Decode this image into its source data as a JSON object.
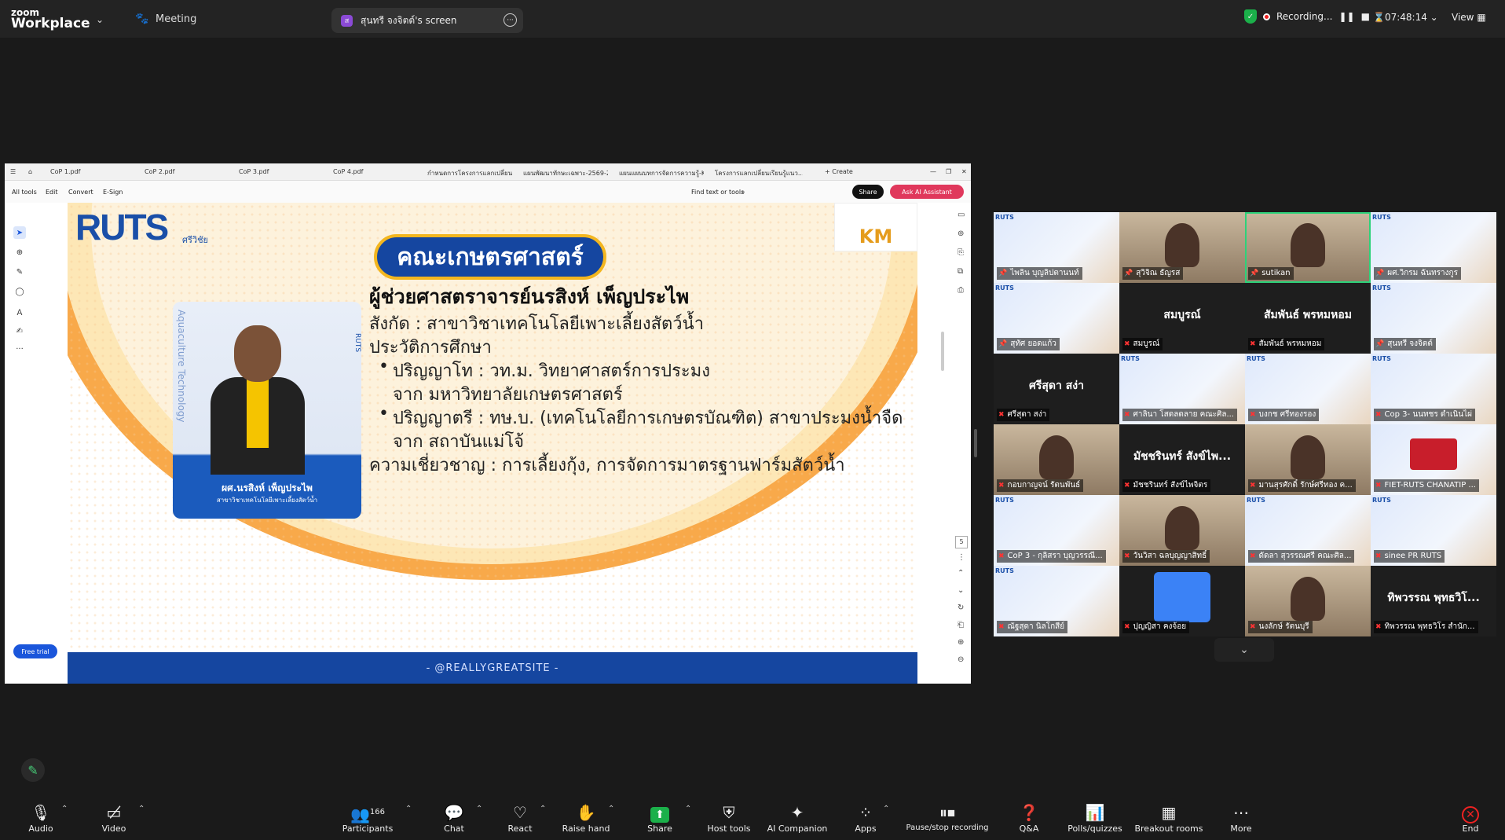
{
  "app": {
    "logo_top": "zoom",
    "logo_bottom": "Workplace",
    "meeting_label": "Meeting"
  },
  "share_tab": {
    "avatar": "ส",
    "title": "สุนทรี จงจิตต์'s screen"
  },
  "recording": {
    "label": "Recording...",
    "timer": "07:48:14",
    "view": "View"
  },
  "pdf": {
    "tabs": [
      "CoP 1.pdf",
      "CoP 2.pdf",
      "CoP 3.pdf",
      "CoP 4.pdf",
      "กำหนดการโครงการแลกเปลี่ยนเรียน...",
      "แผนพัฒนาทักษะเฉพาะ-2569-257...",
      "แผนแผนบทการจัดการความรู้-KM-2...",
      "โครงการแลกเปลี่ยนเรียนรู้แนว...",
      "Create"
    ],
    "tools": {
      "all_tools": "All tools",
      "edit": "Edit",
      "convert": "Convert",
      "esign": "E-Sign",
      "find": "Find text or tools",
      "share": "Share",
      "ai": "Ask AI Assistant",
      "free_trial": "Free trial",
      "page_num": "5"
    }
  },
  "slide": {
    "ruts_logo": "RUTS",
    "ruts_sub": "ศรีวิชัย",
    "km": "KM",
    "faculty": "คณะเกษตรศาสตร์",
    "name": "ผู้ช่วยศาสตราจารย์นรสิงห์ เพ็ญประไพ",
    "affiliation": "สังกัด        : สาขาวิชาเทคโนโลยีเพาะเลี้ยงสัตว์น้ำ",
    "edu_heading": "ประวัติการศึกษา",
    "edu1a": "ปริญญาโท : วท.ม. วิทยาศาสตร์การประมง",
    "edu1b": "จาก  มหาวิทยาลัยเกษตรศาสตร์",
    "edu2a": "ปริญญาตรี : ทษ.บ. (เทคโนโลยีการเกษตรบัณฑิต) สาขาประมงน้ำจืด",
    "edu2b": "จาก  สถาบันแม่โจ้",
    "expertise": "ความเชี่ยวชาญ : การเลี้ยงกุ้ง, การจัดการมาตรฐานฟาร์มสัตว์น้ำ",
    "photo_caption": "ผศ.นรสิงห์   เพ็ญประไพ",
    "photo_sub": "สาขาวิชาเทคโนโลยีเพาะเลี้ยงสัตว์น้ำ",
    "photo_vertical": "Aquaculture Technology",
    "photo_vertical2": "RUTS",
    "footer": "- @REALLYGREATSITE -"
  },
  "gallery": [
    {
      "name": "ไพลิน บุญลิปตานนท์",
      "type": "poster",
      "muted": false,
      "big": ""
    },
    {
      "name": "สุวิจิณ ธัญรส",
      "type": "camera",
      "muted": false,
      "big": ""
    },
    {
      "name": "sutikan",
      "type": "camera-active",
      "muted": false,
      "big": ""
    },
    {
      "name": "ผศ.วิกรม ฉันทรางกูร",
      "type": "poster",
      "muted": false,
      "big": ""
    },
    {
      "name": "สุทัศ ยอดแก้ว",
      "type": "poster",
      "muted": false,
      "big": ""
    },
    {
      "name": "สมบูรณ์",
      "type": "dark",
      "muted": true,
      "big": "สมบูรณ์"
    },
    {
      "name": "สัมพันธ์ พรหมหอม",
      "type": "dark",
      "muted": true,
      "big": "สัมพันธ์ พรหมหอม"
    },
    {
      "name": "สุนทรี จงจิตต์",
      "type": "poster",
      "muted": false,
      "big": ""
    },
    {
      "name": "ศรีสุดา สง่า",
      "type": "dark",
      "muted": true,
      "big": "ศรีสุดา สง่า"
    },
    {
      "name": "ศาลินา โสดลดลาย คณะศิล...",
      "type": "poster",
      "muted": true,
      "big": ""
    },
    {
      "name": "บงกช ศรีทองรอง",
      "type": "poster",
      "muted": true,
      "big": ""
    },
    {
      "name": "Cop 3- นนทชร ดำเนินไผ่",
      "type": "poster",
      "muted": true,
      "big": ""
    },
    {
      "name": "กอบกาญจน์ รัตนพันธ์",
      "type": "camera",
      "muted": true,
      "big": ""
    },
    {
      "name": "มัชชรินทร์ สังข์ไพจิตร",
      "type": "dark",
      "muted": true,
      "big": "มัชชรินทร์ สังข์ไพ..."
    },
    {
      "name": "มานสุรศักดิ์ รักษ์ศรีทอง ค...",
      "type": "camera",
      "muted": true,
      "big": ""
    },
    {
      "name": "FIET-RUTS CHANATIP ...",
      "type": "star",
      "muted": true,
      "big": ""
    },
    {
      "name": "CoP 3 - กุลิสรา บุญวรรณี...",
      "type": "poster",
      "muted": true,
      "big": ""
    },
    {
      "name": "วันวิสา ฉลบุญญาสิทธิ์",
      "type": "camera",
      "muted": true,
      "big": ""
    },
    {
      "name": "ดัดลา สุวรรณศรี คณะศิล...",
      "type": "poster",
      "muted": true,
      "big": ""
    },
    {
      "name": "sinee PR RUTS",
      "type": "poster",
      "muted": true,
      "big": ""
    },
    {
      "name": "ณัฐสุดา นิลโกสีย์",
      "type": "poster",
      "muted": true,
      "big": ""
    },
    {
      "name": "ปุญญิสา คงจ้อย",
      "type": "avatar",
      "muted": true,
      "big": ""
    },
    {
      "name": "นงลักษ์ รัตนบุรี",
      "type": "camera",
      "muted": true,
      "big": ""
    },
    {
      "name": "ทิพวรรณ พุทธวิโร สำนัก...",
      "type": "dark",
      "muted": true,
      "big": "ทิพวรรณ พุทธวิโ..."
    }
  ],
  "toolbar": {
    "audio": "Audio",
    "video": "Video",
    "participants": "Participants",
    "participants_count": "166",
    "chat": "Chat",
    "react": "React",
    "raise_hand": "Raise hand",
    "share": "Share",
    "host_tools": "Host tools",
    "ai_companion": "AI Companion",
    "apps": "Apps",
    "pause_recording": "Pause/stop recording",
    "qa": "Q&A",
    "polls": "Polls/quizzes",
    "breakout": "Breakout rooms",
    "more": "More",
    "end": "End"
  }
}
